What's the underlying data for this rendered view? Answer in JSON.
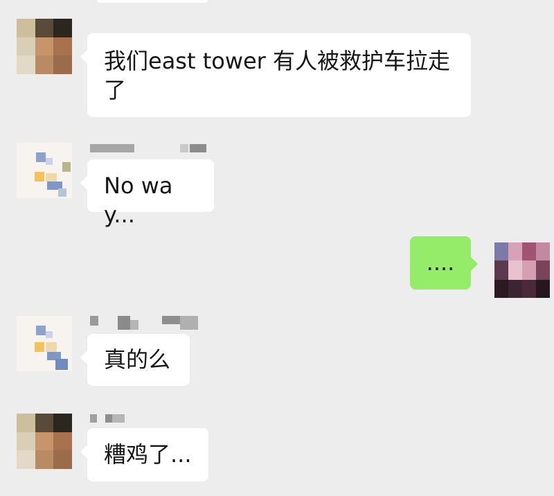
{
  "chat": {
    "messages": [
      {
        "id": "m1",
        "side": "left",
        "text": "我们east tower 有人被救护车拉走了"
      },
      {
        "id": "m2",
        "side": "left",
        "text": "No way..."
      },
      {
        "id": "m3",
        "side": "right",
        "text": "...."
      },
      {
        "id": "m4",
        "side": "left",
        "text": "真的么"
      },
      {
        "id": "m5",
        "side": "left",
        "text": "糟鸡了..."
      }
    ]
  },
  "colors": {
    "background": "#ededed",
    "incoming_bubble": "#ffffff",
    "outgoing_bubble": "#95ec69",
    "text": "#161616"
  }
}
